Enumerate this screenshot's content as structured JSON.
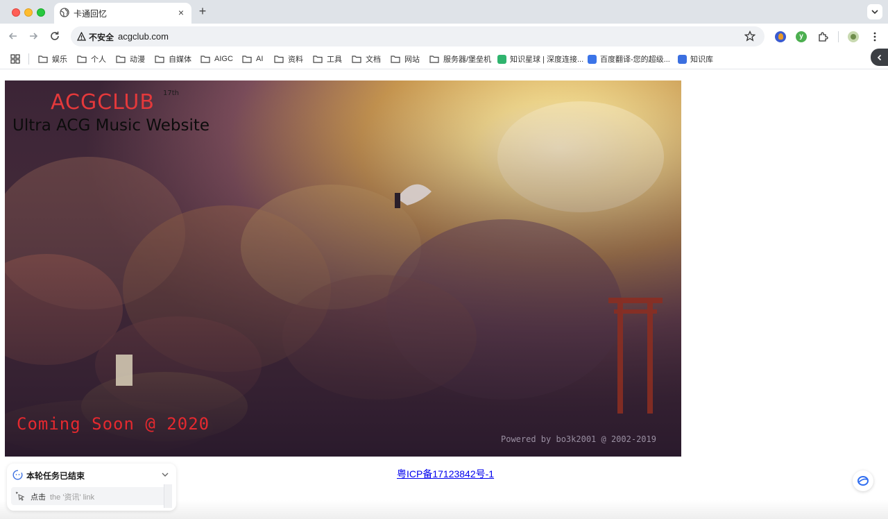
{
  "tab": {
    "title": "卡通回忆"
  },
  "omnibox": {
    "security_label": "不安全",
    "url": "acgclub.com"
  },
  "bookmarks": [
    {
      "label": "娱乐",
      "kind": "folder"
    },
    {
      "label": "个人",
      "kind": "folder"
    },
    {
      "label": "动漫",
      "kind": "folder"
    },
    {
      "label": "自媒体",
      "kind": "folder"
    },
    {
      "label": "AIGC",
      "kind": "folder"
    },
    {
      "label": "AI",
      "kind": "folder"
    },
    {
      "label": "资料",
      "kind": "folder"
    },
    {
      "label": "工具",
      "kind": "folder"
    },
    {
      "label": "文档",
      "kind": "folder"
    },
    {
      "label": "网站",
      "kind": "folder"
    },
    {
      "label": "服务器/堡垒机",
      "kind": "folder"
    },
    {
      "label": "知识星球 | 深度连接...",
      "kind": "site"
    },
    {
      "label": "百度翻译-您的超级...",
      "kind": "site"
    },
    {
      "label": "知识库",
      "kind": "site"
    }
  ],
  "hero": {
    "title": "ACGCLUB",
    "superscript": "17th",
    "subtitle": "Ultra ACG Music Website",
    "coming": "Coming Soon @ 2020",
    "powered": "Powered by bo3k2001 @ 2002-2019"
  },
  "footer": {
    "icp_link": "粤ICP备17123842号-1"
  },
  "task_panel": {
    "title": "本轮任务已结束",
    "step_verb": "点击",
    "step_target": "the '资讯' link"
  },
  "colors": {
    "tabstrip": "#dfe3e8",
    "hero_title": "#e4393b",
    "coming_text": "#e5292f",
    "link": "#0000ee"
  }
}
